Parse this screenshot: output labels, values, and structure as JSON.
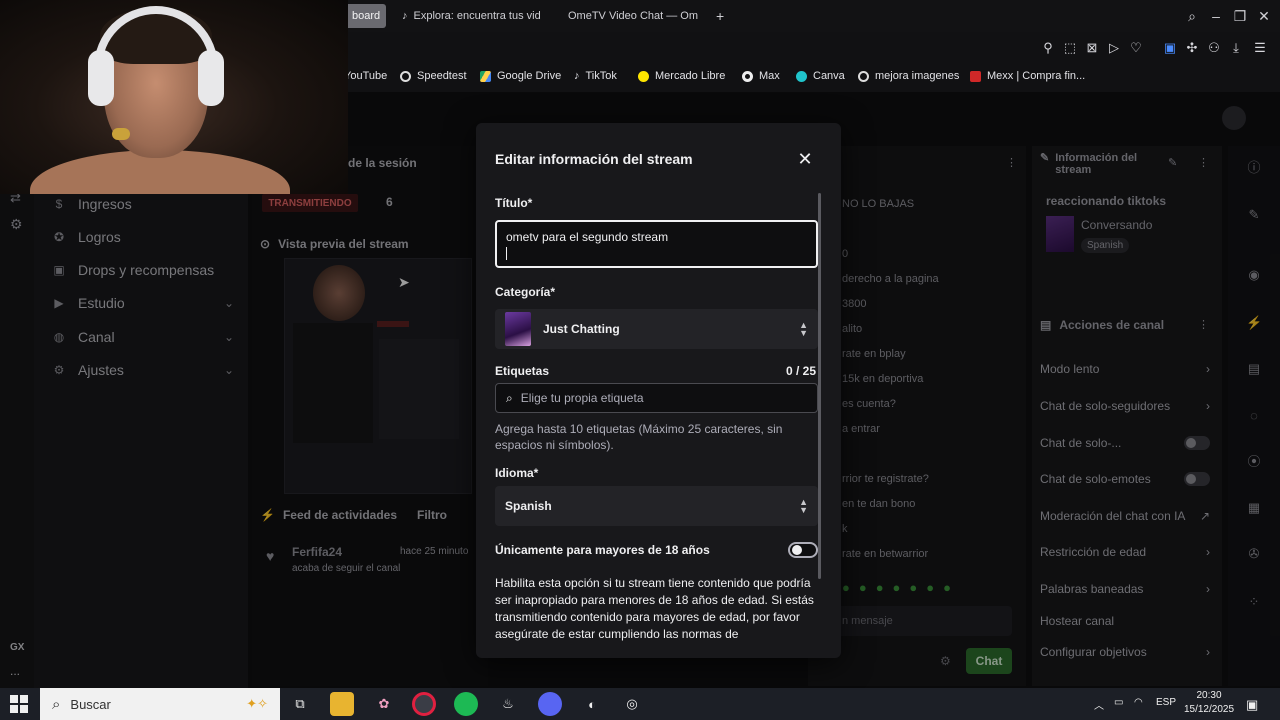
{
  "browser": {
    "tabs": [
      {
        "label": "board",
        "active": true
      },
      {
        "label": "Explora: encuentra tus vid",
        "icon": "tiktok-icon"
      },
      {
        "label": "OmeTV Video Chat — Om",
        "icon": "ometv-icon"
      }
    ],
    "new_tab": "+",
    "bookmarks": [
      "YouTube",
      "Speedtest",
      "Google Drive",
      "TikTok",
      "Mercado Libre",
      "Max",
      "Canva",
      "mejora imagenes",
      "Mexx | Compra fin..."
    ]
  },
  "sidebar": {
    "items": [
      {
        "label": "Ingresos",
        "icon": "dollar-icon"
      },
      {
        "label": "Logros",
        "icon": "trophy-icon"
      },
      {
        "label": "Drops y recompensas",
        "icon": "gift-icon"
      },
      {
        "label": "Estudio",
        "icon": "video-icon",
        "expandable": true
      },
      {
        "label": "Canal",
        "icon": "channel-icon",
        "expandable": true
      },
      {
        "label": "Ajustes",
        "icon": "gear-icon",
        "expandable": true
      }
    ],
    "gx_label": "GX",
    "more": "..."
  },
  "session": {
    "header": "de la sesión",
    "live_badge": "TRANSMITIENDO",
    "viewers": "6",
    "preview_label": "Vista previa del stream",
    "activity_feed": "Feed de actividades",
    "filter": "Filtro",
    "event_user": "Ferfifa24",
    "event_time": "hace 25 minuto",
    "event_text": "acaba de seguir el canal"
  },
  "chat": {
    "lines": [
      "NO LO BAJAS",
      "0",
      "derecho a la pagina",
      "3800",
      "alito",
      "rate en bplay",
      "15k en deportiva",
      "es cuenta?",
      "a entrar",
      "rrior te registrate?",
      "en te dan bono",
      "k",
      "rate en betwarrior"
    ],
    "input_placeholder": "n mensaje",
    "send_label": "Chat"
  },
  "right_panel": {
    "info_title": "Información del stream",
    "stream_title": "reaccionando tiktoks",
    "category": "Conversando",
    "language": "Spanish",
    "actions_title": "Acciones de canal",
    "actions": [
      {
        "label": "Modo lento",
        "type": "chevron"
      },
      {
        "label": "Chat de solo-seguidores",
        "type": "chevron"
      },
      {
        "label": "Chat de solo-...",
        "type": "toggle"
      },
      {
        "label": "Chat de solo-emotes",
        "type": "toggle"
      },
      {
        "label": "Moderación del chat con IA",
        "type": "external"
      },
      {
        "label": "Restricción de edad",
        "type": "chevron"
      },
      {
        "label": "Palabras baneadas",
        "type": "chevron"
      },
      {
        "label": "Hostear canal",
        "type": "none"
      },
      {
        "label": "Configurar objetivos",
        "type": "chevron"
      }
    ]
  },
  "modal": {
    "title": "Editar información del stream",
    "title_label": "Título*",
    "title_value": "ometv para el segundo stream",
    "category_label": "Categoría*",
    "category_value": "Just Chatting",
    "tags_label": "Etiquetas",
    "tags_count": "0 / 25",
    "tags_placeholder": "Elige tu propia etiqueta",
    "tags_help": "Agrega hasta 10 etiquetas (Máximo 25 caracteres, sin espacios ni símbolos).",
    "language_label": "Idioma*",
    "language_value": "Spanish",
    "age_label": "Únicamente para mayores de 18 años",
    "age_enabled": false,
    "age_desc": "Habilita esta opción si tu stream tiene contenido que podría ser inapropiado para menores de 18 años de edad. Si estás transmitiendo contenido para mayores de edad, por favor asegúrate de estar cumpliendo las normas de"
  },
  "taskbar": {
    "search_placeholder": "Buscar",
    "lang": "ESP",
    "time": "20:30",
    "date": "15/12/2025"
  }
}
